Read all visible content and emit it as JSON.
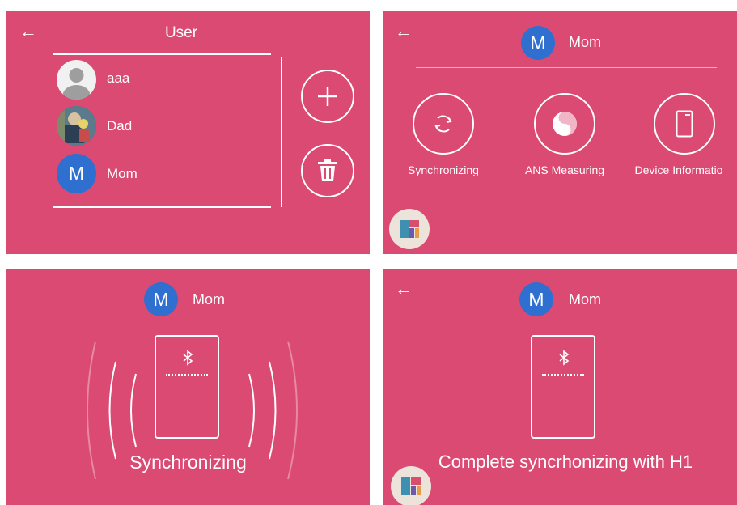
{
  "user_screen": {
    "title": "User",
    "users": [
      {
        "name": "aaa",
        "avatar": "default-person"
      },
      {
        "name": "Dad",
        "avatar": "photo"
      },
      {
        "name": "Mom",
        "avatar": "letter",
        "initial": "M"
      }
    ],
    "add_icon": "plus-icon",
    "delete_icon": "trash-icon"
  },
  "menu_screen": {
    "user_name": "Mom",
    "user_initial": "M",
    "actions": [
      {
        "label": "Synchronizing",
        "icon": "sync-icon"
      },
      {
        "label": "ANS Measuring",
        "icon": "ans-icon"
      },
      {
        "label": "Device Informatio",
        "icon": "device-icon"
      }
    ]
  },
  "sync_screen": {
    "user_name": "Mom",
    "user_initial": "M",
    "status": "Synchronizing"
  },
  "complete_screen": {
    "user_name": "Mom",
    "user_initial": "M",
    "status": "Complete syncrhonizing with H1"
  },
  "colors": {
    "background": "#db4a73",
    "avatar_blue": "#2f6fd0",
    "fab_bg": "#ece3da"
  }
}
